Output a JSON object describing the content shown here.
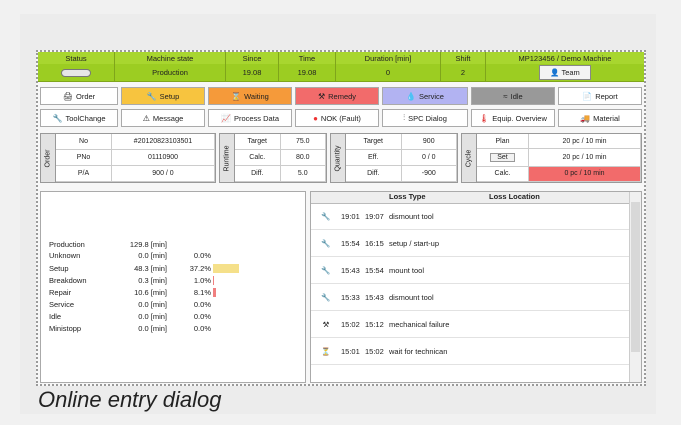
{
  "caption": "Online entry dialog",
  "header": {
    "labels": [
      "Status",
      "Machine state",
      "Since",
      "Time",
      "Duration [min]",
      "Shift",
      "MP123456 / Demo Machine"
    ],
    "values": {
      "machine_state": "Production",
      "since": "19.08",
      "time": "19.08",
      "duration": "0",
      "shift": "2",
      "team": "Team"
    }
  },
  "buttons_row1": [
    "Order",
    "Setup",
    "Waiting",
    "Remedy",
    "Service",
    "Idle",
    "Report"
  ],
  "buttons_row2": [
    "ToolChange",
    "Message",
    "Process Data",
    "NOK (Fault)",
    "SPC Dialog",
    "Equip. Overview",
    "Material"
  ],
  "colors": {
    "setup": "#f7c43f",
    "waiting": "#f59a3a",
    "remedy": "#f26b6b",
    "service": "#b2b3f2",
    "idle": "#999999",
    "header": "#a8d62f",
    "bar_setup": "#f5e08a",
    "bar_repair": "#f08080",
    "calc_red": "#f26b6b"
  },
  "order": {
    "label": "Order",
    "rows": [
      [
        "No",
        "#20120823103501"
      ],
      [
        "PNo",
        "01110900"
      ],
      [
        "P/A",
        "900 / 0"
      ]
    ]
  },
  "runtime": {
    "label": "Runtime",
    "rows": [
      [
        "Target",
        "75.0"
      ],
      [
        "Calc.",
        "80.0"
      ],
      [
        "Diff.",
        "5.0"
      ]
    ]
  },
  "quantity": {
    "label": "Quantity",
    "rows": [
      [
        "Target",
        "900"
      ],
      [
        "Eff.",
        "0 / 0"
      ],
      [
        "Diff.",
        "-900"
      ]
    ]
  },
  "cycle": {
    "label": "Cycle",
    "rows": [
      [
        "Plan",
        "20 pc / 10 min"
      ],
      [
        "Set",
        "20 pc / 10 min"
      ],
      [
        "Calc.",
        "0 pc / 10 min"
      ]
    ]
  },
  "stats": [
    {
      "label": "Production",
      "value": "129.8 [min]",
      "pct": ""
    },
    {
      "label": "Unknown",
      "value": "0.0 [min]",
      "pct": "0.0%"
    },
    {
      "label": "Setup",
      "value": "48.3 [min]",
      "pct": "37.2%"
    },
    {
      "label": "Breakdown",
      "value": "0.3 [min]",
      "pct": "1.0%"
    },
    {
      "label": "Repair",
      "value": "10.6 [min]",
      "pct": "8.1%"
    },
    {
      "label": "Service",
      "value": "0.0 [min]",
      "pct": "0.0%"
    },
    {
      "label": "Idle",
      "value": "0.0 [min]",
      "pct": "0.0%"
    },
    {
      "label": "Ministopp",
      "value": "0.0 [min]",
      "pct": "0.0%"
    }
  ],
  "losses": {
    "headers": {
      "type": "Loss Type",
      "location": "Loss Location"
    },
    "rows": [
      {
        "icon": "setup-icon",
        "start": "19:01",
        "end": "19:07",
        "type": "dismount tool"
      },
      {
        "icon": "setup-icon",
        "start": "15:54",
        "end": "16:15",
        "type": "setup / start-up"
      },
      {
        "icon": "setup-icon",
        "start": "15:43",
        "end": "15:54",
        "type": "mount tool"
      },
      {
        "icon": "setup-icon",
        "start": "15:33",
        "end": "15:43",
        "type": "dismount tool"
      },
      {
        "icon": "hammer-icon",
        "start": "15:02",
        "end": "15:12",
        "type": "mechanical failure"
      },
      {
        "icon": "wait-icon",
        "start": "15:01",
        "end": "15:02",
        "type": "wait for technican"
      }
    ]
  }
}
